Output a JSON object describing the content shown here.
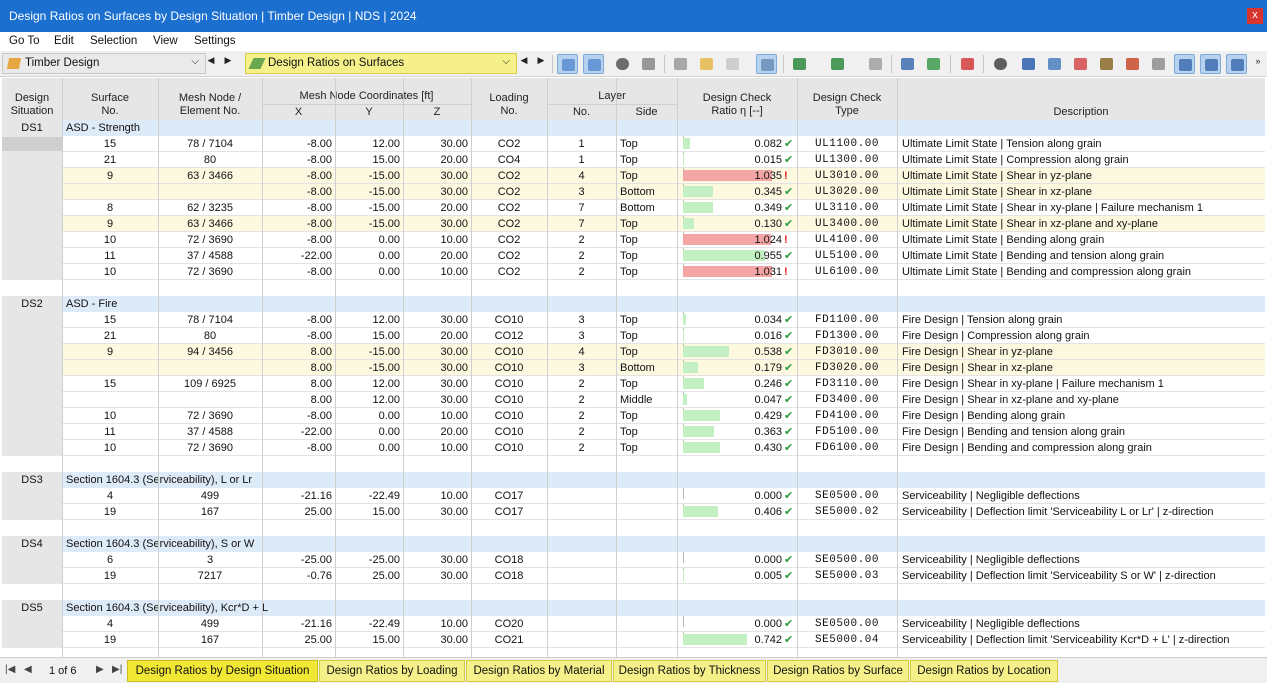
{
  "window": {
    "title": "Design Ratios on Surfaces by Design Situation | Timber Design | NDS | 2024",
    "close_glyph": "x"
  },
  "menu": [
    "Go To",
    "Edit",
    "Selection",
    "View",
    "Settings"
  ],
  "toolbar": {
    "module_combo": "Timber Design",
    "result_combo": "Design Ratios on Surfaces",
    "nav_prev": "◀",
    "nav_next": "▶",
    "dropdown_glyph": "⌵",
    "more_glyph": "»"
  },
  "columns": {
    "ds": "Design\nSituation",
    "surface": "Surface\nNo.",
    "mesh": "Mesh Node /\nElement No.",
    "coords_group": "Mesh Node Coordinates [ft]",
    "x": "X",
    "y": "Y",
    "z": "Z",
    "loading": "Loading\nNo.",
    "layer_group": "Layer",
    "layer_no": "No.",
    "side": "Side",
    "ratio": "Design Check\nRatio η [--]",
    "type": "Design Check\nType",
    "desc": "Description"
  },
  "groups": [
    {
      "ds": "DS1",
      "name": "ASD - Strength",
      "rows": [
        {
          "s": "15",
          "m": "78 / 7104",
          "x": "-8.00",
          "y": "12.00",
          "z": "30.00",
          "lc": "CO2",
          "ln": "1",
          "side": "Top",
          "r": "0.082",
          "ok": true,
          "t": "UL1100.00",
          "d": "Ultimate Limit State | Tension along grain"
        },
        {
          "s": "21",
          "m": "80",
          "x": "-8.00",
          "y": "15.00",
          "z": "20.00",
          "lc": "CO4",
          "ln": "1",
          "side": "Top",
          "r": "0.015",
          "ok": true,
          "t": "UL1300.00",
          "d": "Ultimate Limit State | Compression along grain"
        },
        {
          "s": "9",
          "m": "63 / 3466",
          "x": "-8.00",
          "y": "-15.00",
          "z": "30.00",
          "lc": "CO2",
          "ln": "4",
          "side": "Top",
          "r": "1.035",
          "ok": false,
          "t": "UL3010.00",
          "d": "Ultimate Limit State | Shear in yz-plane",
          "hl": true
        },
        {
          "s": "",
          "m": "",
          "x": "-8.00",
          "y": "-15.00",
          "z": "30.00",
          "lc": "CO2",
          "ln": "3",
          "side": "Bottom",
          "r": "0.345",
          "ok": true,
          "t": "UL3020.00",
          "d": "Ultimate Limit State | Shear in xz-plane",
          "hl": true
        },
        {
          "s": "8",
          "m": "62 / 3235",
          "x": "-8.00",
          "y": "-15.00",
          "z": "20.00",
          "lc": "CO2",
          "ln": "7",
          "side": "Bottom",
          "r": "0.349",
          "ok": true,
          "t": "UL3110.00",
          "d": "Ultimate Limit State | Shear in xy-plane | Failure mechanism 1"
        },
        {
          "s": "9",
          "m": "63 / 3466",
          "x": "-8.00",
          "y": "-15.00",
          "z": "30.00",
          "lc": "CO2",
          "ln": "7",
          "side": "Top",
          "r": "0.130",
          "ok": true,
          "t": "UL3400.00",
          "d": "Ultimate Limit State | Shear in xz-plane and xy-plane",
          "hl": true
        },
        {
          "s": "10",
          "m": "72 / 3690",
          "x": "-8.00",
          "y": "0.00",
          "z": "10.00",
          "lc": "CO2",
          "ln": "2",
          "side": "Top",
          "r": "1.024",
          "ok": false,
          "t": "UL4100.00",
          "d": "Ultimate Limit State | Bending along grain"
        },
        {
          "s": "11",
          "m": "37 / 4588",
          "x": "-22.00",
          "y": "0.00",
          "z": "20.00",
          "lc": "CO2",
          "ln": "2",
          "side": "Top",
          "r": "0.955",
          "ok": true,
          "t": "UL5100.00",
          "d": "Ultimate Limit State | Bending and tension along grain"
        },
        {
          "s": "10",
          "m": "72 / 3690",
          "x": "-8.00",
          "y": "0.00",
          "z": "10.00",
          "lc": "CO2",
          "ln": "2",
          "side": "Top",
          "r": "1.031",
          "ok": false,
          "t": "UL6100.00",
          "d": "Ultimate Limit State | Bending and compression along grain"
        }
      ]
    },
    {
      "ds": "DS2",
      "name": "ASD - Fire",
      "rows": [
        {
          "s": "15",
          "m": "78 / 7104",
          "x": "-8.00",
          "y": "12.00",
          "z": "30.00",
          "lc": "CO10",
          "ln": "3",
          "side": "Top",
          "r": "0.034",
          "ok": true,
          "t": "FD1100.00",
          "d": "Fire Design | Tension along grain"
        },
        {
          "s": "21",
          "m": "80",
          "x": "-8.00",
          "y": "15.00",
          "z": "20.00",
          "lc": "CO12",
          "ln": "3",
          "side": "Top",
          "r": "0.016",
          "ok": true,
          "t": "FD1300.00",
          "d": "Fire Design | Compression along grain"
        },
        {
          "s": "9",
          "m": "94 / 3456",
          "x": "8.00",
          "y": "-15.00",
          "z": "30.00",
          "lc": "CO10",
          "ln": "4",
          "side": "Top",
          "r": "0.538",
          "ok": true,
          "t": "FD3010.00",
          "d": "Fire Design | Shear in yz-plane",
          "hl": true
        },
        {
          "s": "",
          "m": "",
          "x": "8.00",
          "y": "-15.00",
          "z": "30.00",
          "lc": "CO10",
          "ln": "3",
          "side": "Bottom",
          "r": "0.179",
          "ok": true,
          "t": "FD3020.00",
          "d": "Fire Design | Shear in xz-plane",
          "hl": true
        },
        {
          "s": "15",
          "m": "109 / 6925",
          "x": "8.00",
          "y": "12.00",
          "z": "30.00",
          "lc": "CO10",
          "ln": "2",
          "side": "Top",
          "r": "0.246",
          "ok": true,
          "t": "FD3110.00",
          "d": "Fire Design | Shear in xy-plane | Failure mechanism 1"
        },
        {
          "s": "",
          "m": "",
          "x": "8.00",
          "y": "12.00",
          "z": "30.00",
          "lc": "CO10",
          "ln": "2",
          "side": "Middle",
          "r": "0.047",
          "ok": true,
          "t": "FD3400.00",
          "d": "Fire Design | Shear in xz-plane and xy-plane"
        },
        {
          "s": "10",
          "m": "72 / 3690",
          "x": "-8.00",
          "y": "0.00",
          "z": "10.00",
          "lc": "CO10",
          "ln": "2",
          "side": "Top",
          "r": "0.429",
          "ok": true,
          "t": "FD4100.00",
          "d": "Fire Design | Bending along grain"
        },
        {
          "s": "11",
          "m": "37 / 4588",
          "x": "-22.00",
          "y": "0.00",
          "z": "20.00",
          "lc": "CO10",
          "ln": "2",
          "side": "Top",
          "r": "0.363",
          "ok": true,
          "t": "FD5100.00",
          "d": "Fire Design | Bending and tension along grain"
        },
        {
          "s": "10",
          "m": "72 / 3690",
          "x": "-8.00",
          "y": "0.00",
          "z": "10.00",
          "lc": "CO10",
          "ln": "2",
          "side": "Top",
          "r": "0.430",
          "ok": true,
          "t": "FD6100.00",
          "d": "Fire Design | Bending and compression along grain"
        }
      ]
    },
    {
      "ds": "DS3",
      "name": "Section 1604.3 (Serviceability), L or Lr",
      "rows": [
        {
          "s": "4",
          "m": "499",
          "x": "-21.16",
          "y": "-22.49",
          "z": "10.00",
          "lc": "CO17",
          "ln": "",
          "side": "",
          "r": "0.000",
          "ok": true,
          "t": "SE0500.00",
          "d": "Serviceability | Negligible deflections"
        },
        {
          "s": "19",
          "m": "167",
          "x": "25.00",
          "y": "15.00",
          "z": "30.00",
          "lc": "CO17",
          "ln": "",
          "side": "",
          "r": "0.406",
          "ok": true,
          "t": "SE5000.02",
          "d": "Serviceability | Deflection limit 'Serviceability L or Lr' | z-direction"
        }
      ]
    },
    {
      "ds": "DS4",
      "name": "Section 1604.3 (Serviceability), S or W",
      "rows": [
        {
          "s": "6",
          "m": "3",
          "x": "-25.00",
          "y": "-25.00",
          "z": "30.00",
          "lc": "CO18",
          "ln": "",
          "side": "",
          "r": "0.000",
          "ok": true,
          "t": "SE0500.00",
          "d": "Serviceability | Negligible deflections"
        },
        {
          "s": "19",
          "m": "7217",
          "x": "-0.76",
          "y": "25.00",
          "z": "30.00",
          "lc": "CO18",
          "ln": "",
          "side": "",
          "r": "0.005",
          "ok": true,
          "t": "SE5000.03",
          "d": "Serviceability | Deflection limit 'Serviceability S or W' | z-direction"
        }
      ]
    },
    {
      "ds": "DS5",
      "name": "Section 1604.3 (Serviceability), Kcr*D + L",
      "rows": [
        {
          "s": "4",
          "m": "499",
          "x": "-21.16",
          "y": "-22.49",
          "z": "10.00",
          "lc": "CO20",
          "ln": "",
          "side": "",
          "r": "0.000",
          "ok": true,
          "t": "SE0500.00",
          "d": "Serviceability | Negligible deflections"
        },
        {
          "s": "19",
          "m": "167",
          "x": "25.00",
          "y": "15.00",
          "z": "30.00",
          "lc": "CO21",
          "ln": "",
          "side": "",
          "r": "0.742",
          "ok": true,
          "t": "SE5000.04",
          "d": "Serviceability | Deflection limit 'Serviceability Kcr*D + L' | z-direction"
        }
      ]
    }
  ],
  "status_glyphs": {
    "ok": "✔",
    "bad": "!"
  },
  "colors": {
    "title_bar": "#1a6fcf",
    "tab_bg": "#f5f08a",
    "ok_bar": "#c3f0c3",
    "bad_bar": "#f4a6a6",
    "highlight_row": "#fdf9e1",
    "group_row": "#ddeaf7"
  },
  "pager": {
    "first": "|◀",
    "prev": "◀",
    "label": "1 of 6",
    "next": "▶",
    "last": "▶|"
  },
  "tabs": [
    "Design Ratios by Design Situation",
    "Design Ratios by Loading",
    "Design Ratios by Material",
    "Design Ratios by Thickness",
    "Design Ratios by Surface",
    "Design Ratios by Location"
  ],
  "active_tab": 0
}
